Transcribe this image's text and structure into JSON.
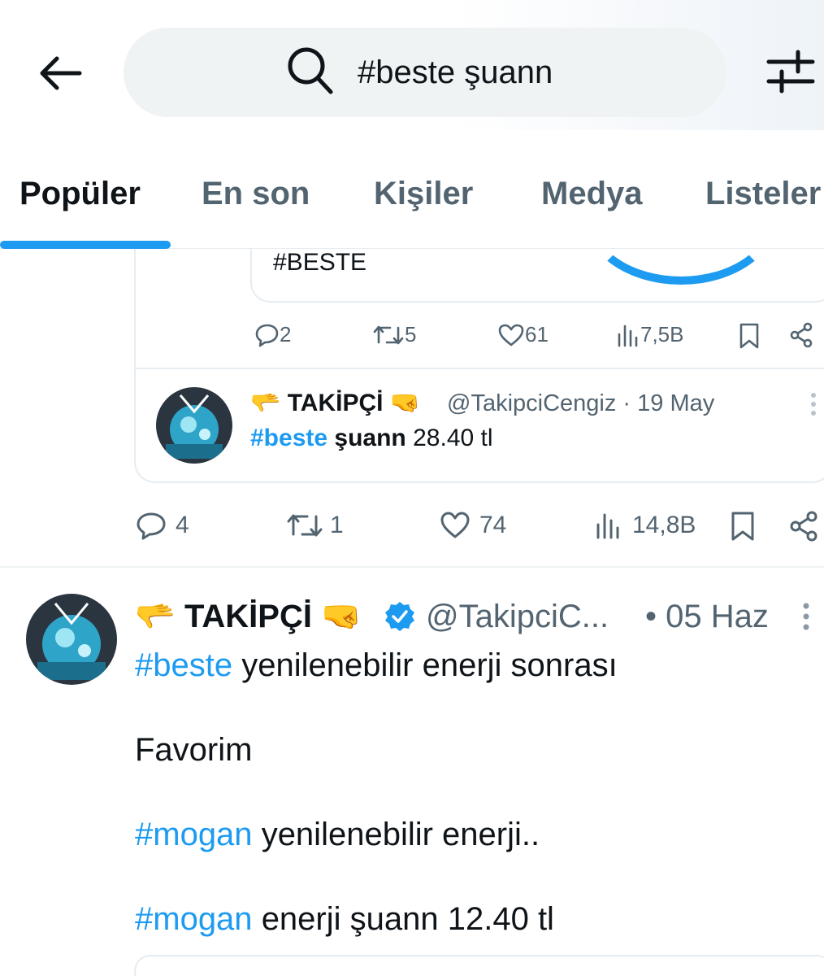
{
  "search": {
    "query": "#beste şuann"
  },
  "tabs": [
    {
      "label": "Popüler"
    },
    {
      "label": "En son"
    },
    {
      "label": "Kişiler"
    },
    {
      "label": "Medya"
    },
    {
      "label": "Listeler"
    }
  ],
  "quoted_card": {
    "text": "#BESTE"
  },
  "quoted_actions": {
    "replies": "2",
    "reposts": "5",
    "likes": "61",
    "views": "7,5B"
  },
  "inner_tweet": {
    "emoji_left": "🫳",
    "name": "TAKİPÇİ",
    "emoji_right": "🤜",
    "handle": "@TakipciCengiz",
    "date": "· 19 May",
    "hashtag": "#beste",
    "text_bold": "şuann",
    "text": "28.40 tl"
  },
  "tweet1_actions": {
    "replies": "4",
    "reposts": "1",
    "likes": "74",
    "views": "14,8B"
  },
  "tweet2": {
    "emoji_left": "🫳",
    "name": "TAKİPÇİ",
    "emoji_right": "🤜",
    "handle": "@TakipciC...",
    "date": "• 05 Haz",
    "line1_tag": "#beste",
    "line1_text": "yenilenebilir enerji sonrası",
    "line2_text": "Favorim",
    "line3_tag": "#mogan",
    "line3_text": "yenilenebilir enerji..",
    "line4_tag": "#mogan",
    "line4_text": "enerji şuann 12.40 tl"
  },
  "colors": {
    "accent": "#1d9bf0",
    "text": "#0f1419",
    "muted": "#536471"
  }
}
